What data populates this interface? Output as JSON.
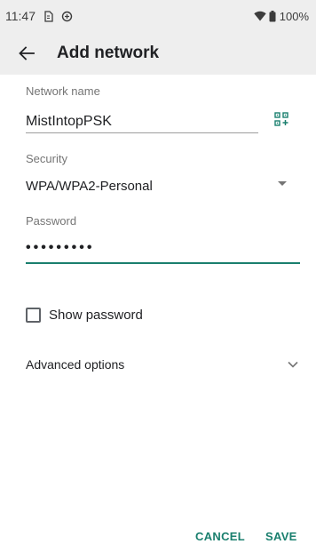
{
  "status_bar": {
    "time": "11:47",
    "battery": "100%",
    "icons": [
      "sim-icon",
      "data-saver-icon",
      "wifi-icon",
      "battery-icon"
    ]
  },
  "app_bar": {
    "title": "Add network",
    "back_icon": "arrow-back-icon"
  },
  "form": {
    "network_name": {
      "label": "Network name",
      "value": "MistIntopPSK",
      "trailing_icon": "qr-code-scan-icon"
    },
    "security": {
      "label": "Security",
      "value": "WPA/WPA2-Personal"
    },
    "password": {
      "label": "Password",
      "value": "•••••••••"
    },
    "show_password": {
      "label": "Show password",
      "checked": false
    },
    "advanced": {
      "label": "Advanced options"
    }
  },
  "actions": {
    "cancel": "CANCEL",
    "save": "SAVE"
  },
  "colors": {
    "accent": "#1a7f6e",
    "bar_background": "#eeeeee",
    "label": "#757575"
  }
}
